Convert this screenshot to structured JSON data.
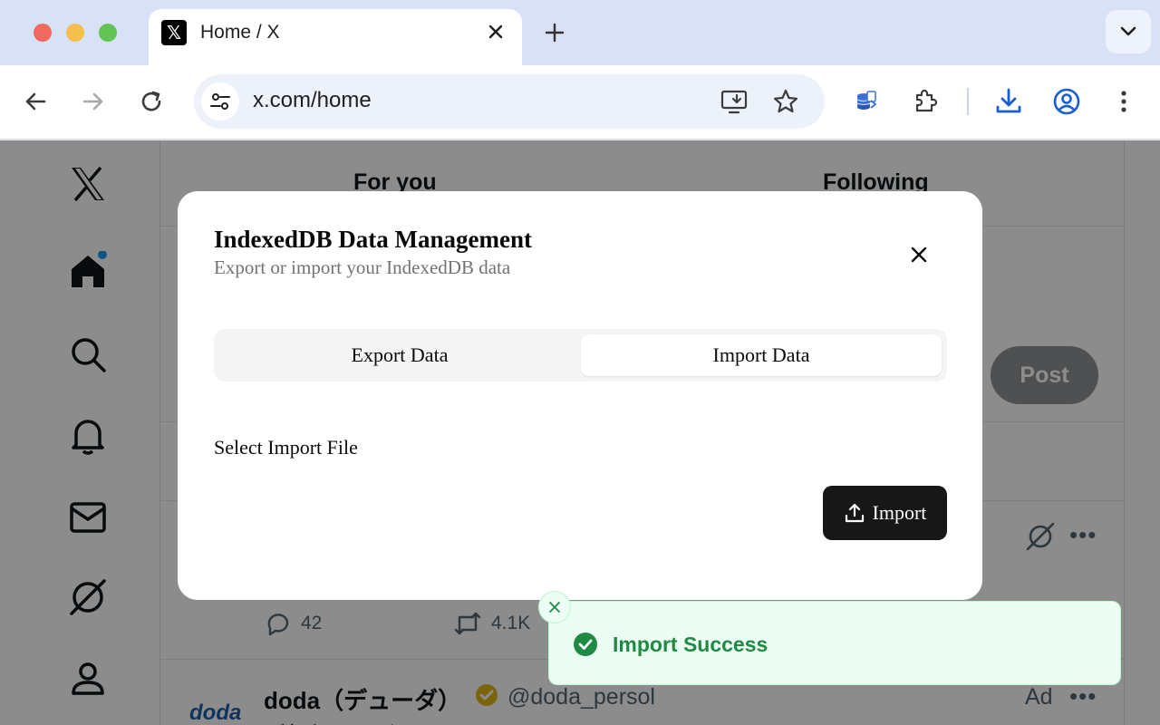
{
  "browser": {
    "tab_title": "Home / X",
    "tab_favicon": "x-logo-icon",
    "url": "x.com/home"
  },
  "x_page": {
    "feed_tabs": [
      "For you",
      "Following"
    ],
    "post_button": "Post",
    "actions": {
      "replies": "42",
      "reposts": "4.1K"
    },
    "ad_tweet": {
      "logo_text": "doda",
      "name": "doda（デューダ）",
      "handle": "@doda_persol",
      "ad_label": "Ad",
      "text": "ご年収をあげたい"
    }
  },
  "dialog": {
    "title": "IndexedDB Data Management",
    "subtitle": "Export or import your IndexedDB data",
    "tabs": {
      "export": "Export Data",
      "import": "Import Data"
    },
    "active_tab": "import",
    "file_label": "Select Import File",
    "import_button": "Import"
  },
  "toast": {
    "message": "Import Success",
    "color": "#1f8a43"
  }
}
